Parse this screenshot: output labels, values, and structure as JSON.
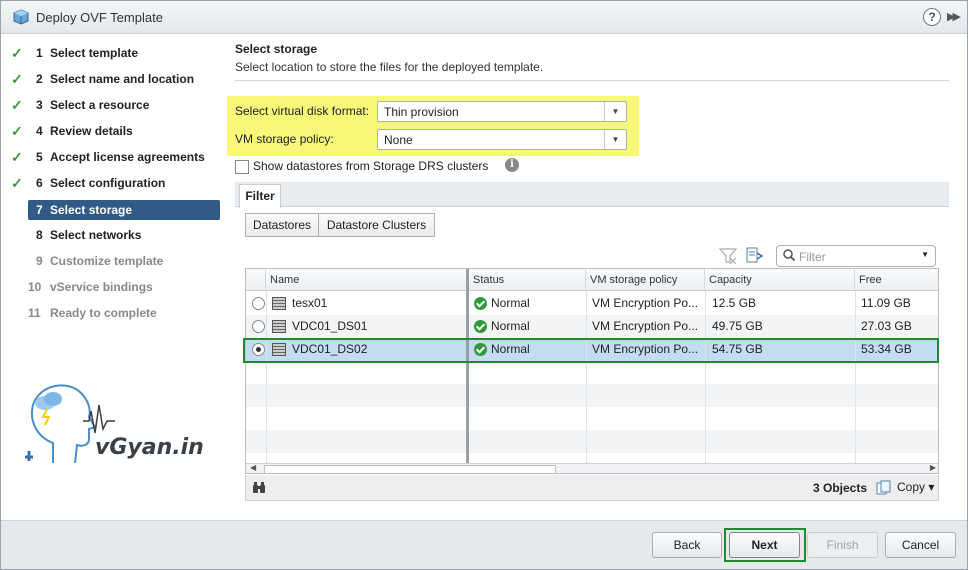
{
  "window": {
    "title": "Deploy OVF Template",
    "help_glyph": "?",
    "expand_glyph": "▶▶"
  },
  "steps": [
    {
      "num": "1",
      "label": "Select template",
      "state": "done"
    },
    {
      "num": "2",
      "label": "Select name and location",
      "state": "done"
    },
    {
      "num": "3",
      "label": "Select a resource",
      "state": "done"
    },
    {
      "num": "4",
      "label": "Review details",
      "state": "done"
    },
    {
      "num": "5",
      "label": "Accept license agreements",
      "state": "done"
    },
    {
      "num": "6",
      "label": "Select configuration",
      "state": "done"
    },
    {
      "num": "7",
      "label": "Select storage",
      "state": "active"
    },
    {
      "num": "8",
      "label": "Select networks",
      "state": "done"
    },
    {
      "num": "9",
      "label": "Customize template",
      "state": "pending"
    },
    {
      "num": "10",
      "label": "vService bindings",
      "state": "pending"
    },
    {
      "num": "11",
      "label": "Ready to complete",
      "state": "pending"
    }
  ],
  "logo": {
    "text": "vGyan.in"
  },
  "main": {
    "title": "Select storage",
    "subtitle": "Select location to store the files for the deployed template.",
    "disk_format_label": "Select virtual disk format:",
    "disk_format_value": "Thin provision",
    "policy_label": "VM storage policy:",
    "policy_value": "None",
    "show_drs_label": "Show datastores from Storage DRS clusters",
    "tab_filter": "Filter",
    "btn_datastores": "Datastores",
    "btn_clusters": "Datastore Clusters",
    "filter_placeholder": "Filter"
  },
  "table": {
    "columns": [
      "Name",
      "Status",
      "VM storage policy",
      "Capacity",
      "Free"
    ],
    "rows": [
      {
        "name": "tesx01",
        "status": "Normal",
        "policy": "VM Encryption Po...",
        "capacity": "12.5 GB",
        "free": "11.09 GB",
        "selected": false
      },
      {
        "name": "VDC01_DS01",
        "status": "Normal",
        "policy": "VM Encryption Po...",
        "capacity": "49.75 GB",
        "free": "27.03 GB",
        "selected": false
      },
      {
        "name": "VDC01_DS02",
        "status": "Normal",
        "policy": "VM Encryption Po...",
        "capacity": "54.75 GB",
        "free": "53.34 GB",
        "selected": true
      }
    ],
    "count_label": "3 Objects",
    "copy_label": "Copy ▾"
  },
  "footer": {
    "back": "Back",
    "next": "Next",
    "finish": "Finish",
    "cancel": "Cancel"
  },
  "colors": {
    "active_step": "#315a86",
    "highlight": "#f7f77a",
    "selection_outline": "#1f8a2e",
    "selected_row": "#c4dcf2"
  }
}
